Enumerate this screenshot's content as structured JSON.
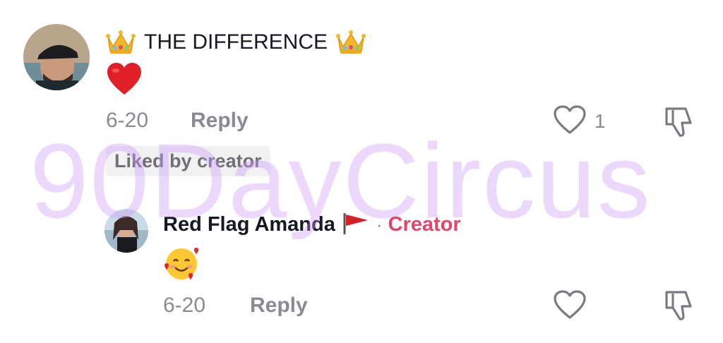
{
  "comment": {
    "author_avatar": "avatar-man-cap",
    "text": "THE DIFFERENCE",
    "lead_emoji": "crown",
    "trail_emoji": "crown",
    "second_line_emoji": "red-heart",
    "date": "6-20",
    "reply_label": "Reply",
    "like_count": "1",
    "liked_by_creator": "Liked by creator"
  },
  "reply": {
    "author_avatar": "avatar-woman",
    "username": "Red Flag Amanda",
    "username_emoji": "red-flag",
    "separator": "·",
    "badge": "Creator",
    "text_emoji": "smiling-face-with-hearts",
    "date": "6-20",
    "reply_label": "Reply"
  },
  "watermark": "90DayCircus",
  "colors": {
    "text": "#161823",
    "muted": "#8a8b91",
    "creator": "#e6456b",
    "watermark": "#d6a6f8"
  }
}
